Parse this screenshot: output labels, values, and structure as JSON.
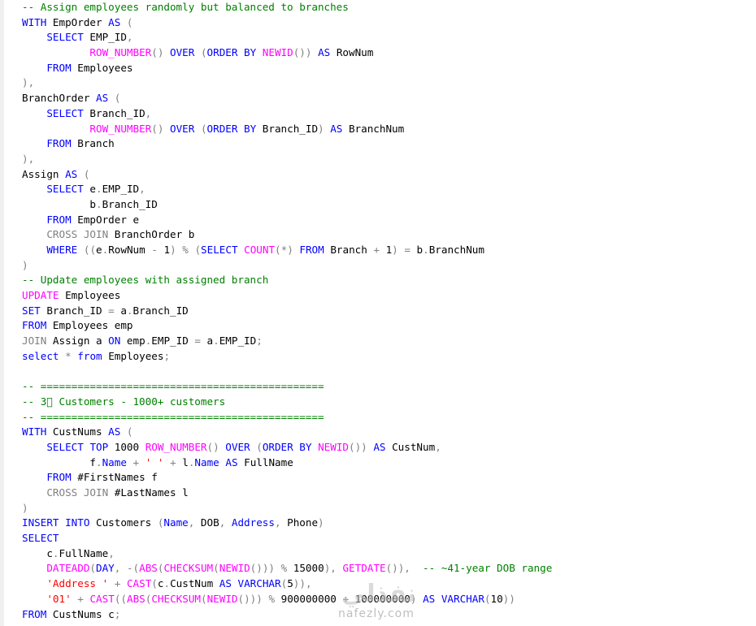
{
  "editor": {
    "lines": [
      [
        [
          "cm",
          "-- Assign employees randomly but balanced to branches"
        ]
      ],
      [
        [
          "kw",
          "WITH"
        ],
        [
          "plain",
          " EmpOrder "
        ],
        [
          "kw",
          "AS"
        ],
        [
          "gray",
          " ("
        ]
      ],
      [
        [
          "plain",
          "    "
        ],
        [
          "kw",
          "SELECT"
        ],
        [
          "plain",
          " EMP_ID"
        ],
        [
          "gray",
          ","
        ]
      ],
      [
        [
          "plain",
          "           "
        ],
        [
          "fn",
          "ROW_NUMBER"
        ],
        [
          "gray",
          "()"
        ],
        [
          "plain",
          " "
        ],
        [
          "kw",
          "OVER"
        ],
        [
          "plain",
          " "
        ],
        [
          "gray",
          "("
        ],
        [
          "kw",
          "ORDER BY"
        ],
        [
          "plain",
          " "
        ],
        [
          "fn",
          "NEWID"
        ],
        [
          "gray",
          "())"
        ],
        [
          "plain",
          " "
        ],
        [
          "kw",
          "AS"
        ],
        [
          "plain",
          " RowNum"
        ]
      ],
      [
        [
          "plain",
          "    "
        ],
        [
          "kw",
          "FROM"
        ],
        [
          "plain",
          " Employees"
        ]
      ],
      [
        [
          "gray",
          "),"
        ]
      ],
      [
        [
          "plain",
          "BranchOrder "
        ],
        [
          "kw",
          "AS"
        ],
        [
          "gray",
          " ("
        ]
      ],
      [
        [
          "plain",
          "    "
        ],
        [
          "kw",
          "SELECT"
        ],
        [
          "plain",
          " Branch_ID"
        ],
        [
          "gray",
          ","
        ]
      ],
      [
        [
          "plain",
          "           "
        ],
        [
          "fn",
          "ROW_NUMBER"
        ],
        [
          "gray",
          "()"
        ],
        [
          "plain",
          " "
        ],
        [
          "kw",
          "OVER"
        ],
        [
          "plain",
          " "
        ],
        [
          "gray",
          "("
        ],
        [
          "kw",
          "ORDER BY"
        ],
        [
          "plain",
          " Branch_ID"
        ],
        [
          "gray",
          ")"
        ],
        [
          "plain",
          " "
        ],
        [
          "kw",
          "AS"
        ],
        [
          "plain",
          " BranchNum"
        ]
      ],
      [
        [
          "plain",
          "    "
        ],
        [
          "kw",
          "FROM"
        ],
        [
          "plain",
          " Branch"
        ]
      ],
      [
        [
          "gray",
          "),"
        ]
      ],
      [
        [
          "plain",
          "Assign "
        ],
        [
          "kw",
          "AS"
        ],
        [
          "gray",
          " ("
        ]
      ],
      [
        [
          "plain",
          "    "
        ],
        [
          "kw",
          "SELECT"
        ],
        [
          "plain",
          " e"
        ],
        [
          "gray",
          "."
        ],
        [
          "plain",
          "EMP_ID"
        ],
        [
          "gray",
          ","
        ]
      ],
      [
        [
          "plain",
          "           b"
        ],
        [
          "gray",
          "."
        ],
        [
          "plain",
          "Branch_ID"
        ]
      ],
      [
        [
          "plain",
          "    "
        ],
        [
          "kw",
          "FROM"
        ],
        [
          "plain",
          " EmpOrder e"
        ]
      ],
      [
        [
          "plain",
          "    "
        ],
        [
          "gray",
          "CROSS JOIN"
        ],
        [
          "plain",
          " BranchOrder b"
        ]
      ],
      [
        [
          "plain",
          "    "
        ],
        [
          "kw",
          "WHERE"
        ],
        [
          "plain",
          " "
        ],
        [
          "gray",
          "(("
        ],
        [
          "plain",
          "e"
        ],
        [
          "gray",
          "."
        ],
        [
          "plain",
          "RowNum "
        ],
        [
          "gray",
          "-"
        ],
        [
          "plain",
          " 1"
        ],
        [
          "gray",
          ")"
        ],
        [
          "plain",
          " "
        ],
        [
          "gray",
          "%"
        ],
        [
          "plain",
          " "
        ],
        [
          "gray",
          "("
        ],
        [
          "kw",
          "SELECT"
        ],
        [
          "plain",
          " "
        ],
        [
          "fn",
          "COUNT"
        ],
        [
          "gray",
          "(*)"
        ],
        [
          "plain",
          " "
        ],
        [
          "kw",
          "FROM"
        ],
        [
          "plain",
          " Branch "
        ],
        [
          "gray",
          "+"
        ],
        [
          "plain",
          " 1"
        ],
        [
          "gray",
          ")"
        ],
        [
          "plain",
          " "
        ],
        [
          "gray",
          "="
        ],
        [
          "plain",
          " b"
        ],
        [
          "gray",
          "."
        ],
        [
          "plain",
          "BranchNum"
        ]
      ],
      [
        [
          "gray",
          ")"
        ]
      ],
      [
        [
          "cm",
          "-- Update employees with assigned branch"
        ]
      ],
      [
        [
          "fn",
          "UPDATE"
        ],
        [
          "plain",
          " Employees"
        ]
      ],
      [
        [
          "kw",
          "SET"
        ],
        [
          "plain",
          " Branch_ID "
        ],
        [
          "gray",
          "="
        ],
        [
          "plain",
          " a"
        ],
        [
          "gray",
          "."
        ],
        [
          "plain",
          "Branch_ID"
        ]
      ],
      [
        [
          "kw",
          "FROM"
        ],
        [
          "plain",
          " Employees emp"
        ]
      ],
      [
        [
          "gray",
          "JOIN"
        ],
        [
          "plain",
          " Assign a "
        ],
        [
          "kw",
          "ON"
        ],
        [
          "plain",
          " emp"
        ],
        [
          "gray",
          "."
        ],
        [
          "plain",
          "EMP_ID "
        ],
        [
          "gray",
          "="
        ],
        [
          "plain",
          " a"
        ],
        [
          "gray",
          "."
        ],
        [
          "plain",
          "EMP_ID"
        ],
        [
          "gray",
          ";"
        ]
      ],
      [
        [
          "kw",
          "select"
        ],
        [
          "plain",
          " "
        ],
        [
          "gray",
          "*"
        ],
        [
          "plain",
          " "
        ],
        [
          "kw",
          "from"
        ],
        [
          "plain",
          " Employees"
        ],
        [
          "gray",
          ";"
        ]
      ],
      [
        [
          "plain",
          " "
        ]
      ],
      [
        [
          "cm",
          "-- =============================================="
        ]
      ],
      [
        [
          "cm",
          "-- 3⃣ Customers - 1000+ customers"
        ]
      ],
      [
        [
          "cm",
          "-- =============================================="
        ]
      ],
      [
        [
          "kw",
          "WITH"
        ],
        [
          "plain",
          " CustNums "
        ],
        [
          "kw",
          "AS"
        ],
        [
          "gray",
          " ("
        ]
      ],
      [
        [
          "plain",
          "    "
        ],
        [
          "kw",
          "SELECT"
        ],
        [
          "plain",
          " "
        ],
        [
          "kw",
          "TOP"
        ],
        [
          "plain",
          " 1000 "
        ],
        [
          "fn",
          "ROW_NUMBER"
        ],
        [
          "gray",
          "()"
        ],
        [
          "plain",
          " "
        ],
        [
          "kw",
          "OVER"
        ],
        [
          "plain",
          " "
        ],
        [
          "gray",
          "("
        ],
        [
          "kw",
          "ORDER BY"
        ],
        [
          "plain",
          " "
        ],
        [
          "fn",
          "NEWID"
        ],
        [
          "gray",
          "())"
        ],
        [
          "plain",
          " "
        ],
        [
          "kw",
          "AS"
        ],
        [
          "plain",
          " CustNum"
        ],
        [
          "gray",
          ","
        ]
      ],
      [
        [
          "plain",
          "           f"
        ],
        [
          "gray",
          "."
        ],
        [
          "kw",
          "Name"
        ],
        [
          "plain",
          " "
        ],
        [
          "gray",
          "+"
        ],
        [
          "plain",
          " "
        ],
        [
          "str",
          "' '"
        ],
        [
          "plain",
          " "
        ],
        [
          "gray",
          "+"
        ],
        [
          "plain",
          " l"
        ],
        [
          "gray",
          "."
        ],
        [
          "kw",
          "Name"
        ],
        [
          "plain",
          " "
        ],
        [
          "kw",
          "AS"
        ],
        [
          "plain",
          " FullName"
        ]
      ],
      [
        [
          "plain",
          "    "
        ],
        [
          "kw",
          "FROM"
        ],
        [
          "plain",
          " #FirstNames f"
        ]
      ],
      [
        [
          "plain",
          "    "
        ],
        [
          "gray",
          "CROSS JOIN"
        ],
        [
          "plain",
          " #LastNames l"
        ]
      ],
      [
        [
          "gray",
          ")"
        ]
      ],
      [
        [
          "kw",
          "INSERT INTO"
        ],
        [
          "plain",
          " Customers "
        ],
        [
          "gray",
          "("
        ],
        [
          "kw",
          "Name"
        ],
        [
          "gray",
          ","
        ],
        [
          "plain",
          " DOB"
        ],
        [
          "gray",
          ","
        ],
        [
          "plain",
          " "
        ],
        [
          "kw",
          "Address"
        ],
        [
          "gray",
          ","
        ],
        [
          "plain",
          " Phone"
        ],
        [
          "gray",
          ")"
        ]
      ],
      [
        [
          "kw",
          "SELECT"
        ]
      ],
      [
        [
          "plain",
          "    c"
        ],
        [
          "gray",
          "."
        ],
        [
          "plain",
          "FullName"
        ],
        [
          "gray",
          ","
        ]
      ],
      [
        [
          "plain",
          "    "
        ],
        [
          "fn",
          "DATEADD"
        ],
        [
          "gray",
          "("
        ],
        [
          "kw",
          "DAY"
        ],
        [
          "gray",
          ","
        ],
        [
          "plain",
          " "
        ],
        [
          "gray",
          "-("
        ],
        [
          "fn",
          "ABS"
        ],
        [
          "gray",
          "("
        ],
        [
          "fn",
          "CHECKSUM"
        ],
        [
          "gray",
          "("
        ],
        [
          "fn",
          "NEWID"
        ],
        [
          "gray",
          "()))"
        ],
        [
          "plain",
          " "
        ],
        [
          "gray",
          "%"
        ],
        [
          "plain",
          " 15000"
        ],
        [
          "gray",
          "),"
        ],
        [
          "plain",
          " "
        ],
        [
          "fn",
          "GETDATE"
        ],
        [
          "gray",
          "()),"
        ],
        [
          "plain",
          "  "
        ],
        [
          "cm",
          "-- ~41-year DOB range"
        ]
      ],
      [
        [
          "plain",
          "    "
        ],
        [
          "str",
          "'Address '"
        ],
        [
          "plain",
          " "
        ],
        [
          "gray",
          "+"
        ],
        [
          "plain",
          " "
        ],
        [
          "fn",
          "CAST"
        ],
        [
          "gray",
          "("
        ],
        [
          "plain",
          "c"
        ],
        [
          "gray",
          "."
        ],
        [
          "plain",
          "CustNum "
        ],
        [
          "kw",
          "AS"
        ],
        [
          "plain",
          " "
        ],
        [
          "kw",
          "VARCHAR"
        ],
        [
          "gray",
          "("
        ],
        [
          "plain",
          "5"
        ],
        [
          "gray",
          ")),"
        ]
      ],
      [
        [
          "plain",
          "    "
        ],
        [
          "str",
          "'01'"
        ],
        [
          "plain",
          " "
        ],
        [
          "gray",
          "+"
        ],
        [
          "plain",
          " "
        ],
        [
          "fn",
          "CAST"
        ],
        [
          "gray",
          "(("
        ],
        [
          "fn",
          "ABS"
        ],
        [
          "gray",
          "("
        ],
        [
          "fn",
          "CHECKSUM"
        ],
        [
          "gray",
          "("
        ],
        [
          "fn",
          "NEWID"
        ],
        [
          "gray",
          "()))"
        ],
        [
          "plain",
          " "
        ],
        [
          "gray",
          "%"
        ],
        [
          "plain",
          " 900000000 "
        ],
        [
          "gray",
          "+"
        ],
        [
          "plain",
          " 100000000"
        ],
        [
          "gray",
          ")"
        ],
        [
          "plain",
          " "
        ],
        [
          "kw",
          "AS"
        ],
        [
          "plain",
          " "
        ],
        [
          "kw",
          "VARCHAR"
        ],
        [
          "gray",
          "("
        ],
        [
          "plain",
          "10"
        ],
        [
          "gray",
          "))"
        ]
      ],
      [
        [
          "kw",
          "FROM"
        ],
        [
          "plain",
          " CustNums c"
        ],
        [
          "gray",
          ";"
        ]
      ]
    ]
  },
  "watermark": {
    "glyph": "نفذلي",
    "text": "nafezly.com"
  }
}
